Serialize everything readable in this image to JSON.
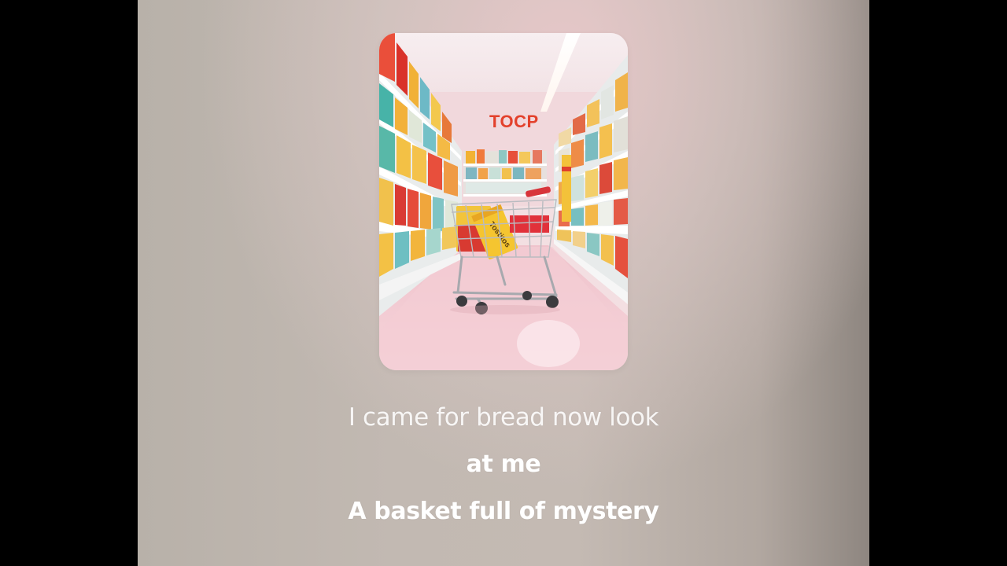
{
  "artwork": {
    "store_sign": "TOCP",
    "box_label": "Tostitos",
    "colors": {
      "wall": "#f3dfe2",
      "floor": "#f3c9d1",
      "sign": "#e3412c",
      "shelf": "#f0efee",
      "cart": "#c9c9cc"
    }
  },
  "lyrics": {
    "line1": "I came for bread now look",
    "line2": "at me",
    "line3": "A basket full of mystery"
  }
}
